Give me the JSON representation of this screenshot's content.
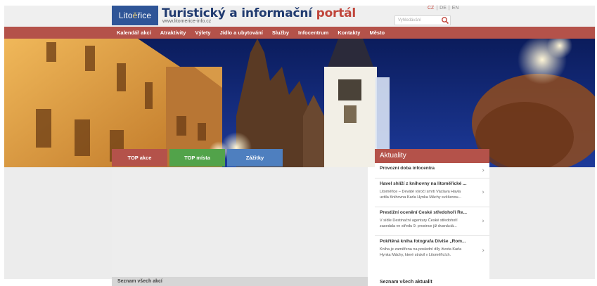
{
  "header": {
    "logo_text_1": "Lito",
    "logo_mark": "ě",
    "logo_text_2": "řice",
    "title_main": "Turistický a informační ",
    "title_accent": "portál",
    "url": "www.litomerice-info.cz",
    "search_placeholder": "Vyhledávání",
    "search_icon": "search-icon",
    "languages": [
      "CZ",
      "DE",
      "EN"
    ],
    "active_language": "CZ"
  },
  "nav": {
    "items": [
      "Kalendář akcí",
      "Atraktivity",
      "Výlety",
      "Jídlo a ubytování",
      "Služby",
      "Infocentrum",
      "Kontakty",
      "Město"
    ]
  },
  "tabs": [
    {
      "label": "TOP akce",
      "color": "#b4524a"
    },
    {
      "label": "TOP místa",
      "color": "#52a34a"
    },
    {
      "label": "Zážitky",
      "color": "#4e7fbf"
    }
  ],
  "main": {
    "footer_link": "Seznam všech akcí"
  },
  "news": {
    "header": "Aktuality",
    "items": [
      {
        "title": "Provozní doba infocentra",
        "text": ""
      },
      {
        "title": "Havel shlíží z knihovny na litoměřické ...",
        "text_line1": "Litoměřice – Deváté výročí smrti Václava Havla",
        "text_line2": "uctila Knihovna Karla Hynka Máchy svěšenou..."
      },
      {
        "title": "Prestižní ocenění České středohoří Re...",
        "text_line1": "V sídle Destinační agentury České středohoří",
        "text_line2": "zasedala ve středu 9. prosince již dvanáctá..."
      },
      {
        "title": "Pokřtěná kniha fotografa Diviše „Rom...",
        "text_line1": "Kniha je zaměřena na poslední díly života Karla",
        "text_line2": "Hynka Máchy, které strávil v Litoměřicích."
      }
    ],
    "all_link": "Seznam všech aktualit",
    "chevron": "›"
  },
  "colors": {
    "brand_red": "#b4524a",
    "brand_blue": "#2f5597",
    "tab_green": "#52a34a",
    "tab_blue": "#4e7fbf"
  }
}
